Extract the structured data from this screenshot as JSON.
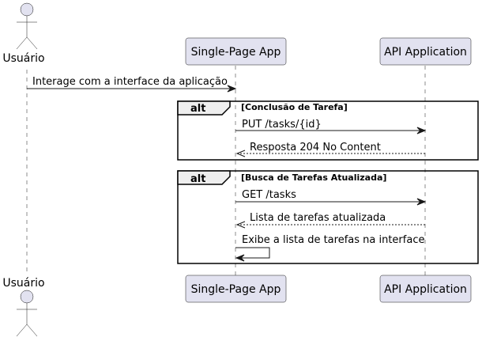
{
  "participants": {
    "user": "Usuário",
    "spa": "Single-Page App",
    "api": "API Application"
  },
  "messages": [
    "Interage com a interface da aplicação",
    "PUT /tasks/{id}",
    "Resposta 204 No Content",
    "GET /tasks",
    "Lista de tarefas atualizada",
    "Exibe a lista de tarefas na interface"
  ],
  "fragments": [
    {
      "keyword": "alt",
      "guard": "[Conclusão de Tarefa]"
    },
    {
      "keyword": "alt",
      "guard": "[Busca de Tarefas Atualizada]"
    }
  ]
}
